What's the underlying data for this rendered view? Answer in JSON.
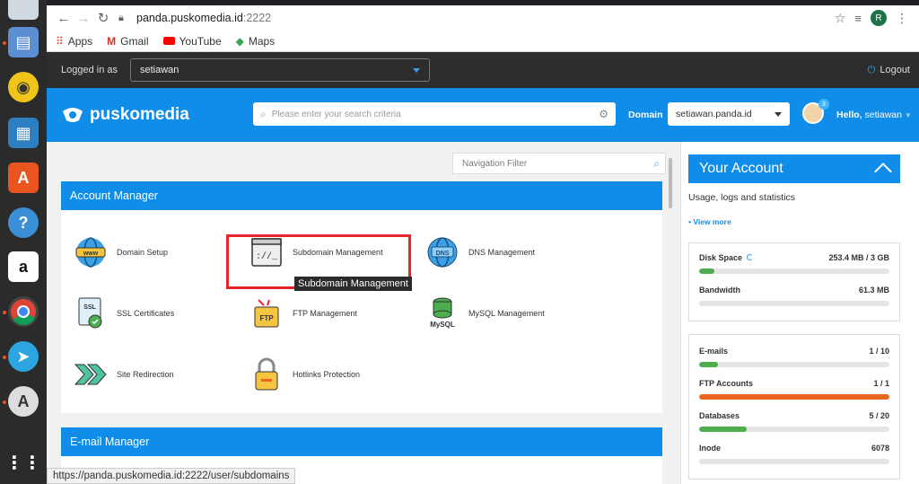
{
  "browser": {
    "url_host": "panda.puskomedia.id",
    "url_port": ":2222",
    "profile_initial": "R",
    "bookmarks": [
      {
        "label": "Apps",
        "icon": "apps-grid-icon"
      },
      {
        "label": "Gmail",
        "icon": "gmail-icon"
      },
      {
        "label": "YouTube",
        "icon": "youtube-icon"
      },
      {
        "label": "Maps",
        "icon": "maps-icon"
      }
    ],
    "status_url": "https://panda.puskomedia.id:2222/user/subdomains"
  },
  "topbar": {
    "logged_in_label": "Logged in as",
    "user": "setiawan",
    "logout_label": "Logout"
  },
  "header": {
    "logo_text": "puskomedia",
    "search_placeholder": "Please enter your search criteria",
    "domain_label": "Domain",
    "domain_value": "setiawan.panda.id",
    "notification_count": "3",
    "hello_prefix": "Hello,",
    "hello_user": "setiawan"
  },
  "main": {
    "nav_filter_placeholder": "Navigation Filter",
    "account_manager_title": "Account Manager",
    "email_manager_title": "E-mail Manager",
    "items": [
      {
        "label": "Domain Setup",
        "icon": "www-globe-icon"
      },
      {
        "label": "Subdomain Management",
        "icon": "subdomain-window-icon"
      },
      {
        "label": "DNS Management",
        "icon": "dns-globe-icon"
      },
      {
        "label": "SSL Certificates",
        "icon": "ssl-certificate-icon"
      },
      {
        "label": "FTP Management",
        "icon": "ftp-folder-icon"
      },
      {
        "label": "MySQL Management",
        "icon": "mysql-database-icon"
      },
      {
        "label": "Site Redirection",
        "icon": "redirect-arrows-icon"
      },
      {
        "label": "Hotlinks Protection",
        "icon": "padlock-icon"
      }
    ],
    "tooltip": "Subdomain Management"
  },
  "account": {
    "title": "Your Account",
    "subtitle": "Usage, logs and statistics",
    "view_more": "• View more",
    "group1": [
      {
        "label": "Disk Space",
        "value": "253.4 MB / 3 GB",
        "fill": 0.08,
        "color": "#4cae4f"
      },
      {
        "label": "Bandwidth",
        "value": "61.3 MB",
        "fill": 0,
        "color": "#4cae4f"
      }
    ],
    "group2": [
      {
        "label": "E-mails",
        "value": "1 / 10",
        "fill": 0.1,
        "color": "#4cae4f"
      },
      {
        "label": "FTP Accounts",
        "value": "1 / 1",
        "fill": 1.0,
        "color": "#e8671c"
      },
      {
        "label": "Databases",
        "value": "5 / 20",
        "fill": 0.25,
        "color": "#4cae4f"
      },
      {
        "label": "Inode",
        "value": "6078",
        "fill": 0,
        "color": "#4cae4f"
      }
    ]
  },
  "colors": {
    "brand_blue": "#0f8de8",
    "highlight_red": "#e8232a"
  }
}
